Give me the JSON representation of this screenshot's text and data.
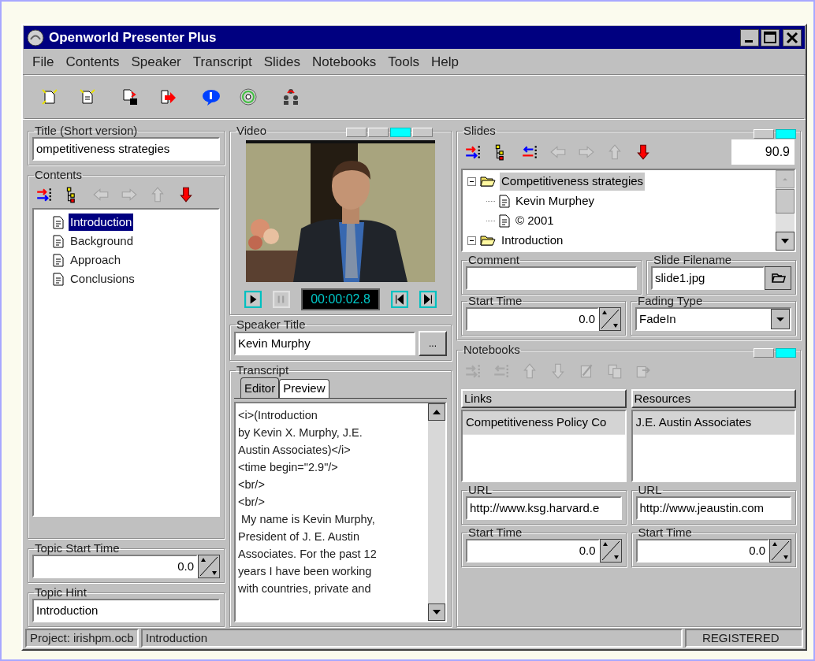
{
  "window": {
    "title": "Openworld Presenter Plus"
  },
  "menu": [
    {
      "label": "File"
    },
    {
      "label": "Contents"
    },
    {
      "label": "Speaker"
    },
    {
      "label": "Transcript"
    },
    {
      "label": "Slides"
    },
    {
      "label": "Notebooks"
    },
    {
      "label": "Tools"
    },
    {
      "label": "Help"
    }
  ],
  "title_group": {
    "label": "Title (Short version)",
    "value": "ompetitiveness strategies"
  },
  "contents": {
    "label": "Contents",
    "tools": [
      {
        "kind": "add",
        "disabled": false
      },
      {
        "kind": "outline",
        "disabled": false
      },
      {
        "kind": "left",
        "disabled": true
      },
      {
        "kind": "right",
        "disabled": true
      },
      {
        "kind": "up",
        "disabled": true
      },
      {
        "kind": "down",
        "disabled": false
      }
    ],
    "items": [
      {
        "label": "Introduction",
        "selected": true
      },
      {
        "label": "Background",
        "selected": false
      },
      {
        "label": "Approach",
        "selected": false
      },
      {
        "label": "Conclusions",
        "selected": false
      }
    ]
  },
  "topic_start_time": {
    "label": "Topic Start Time",
    "value": "0.0"
  },
  "topic_hint": {
    "label": "Topic Hint",
    "value": "Introduction"
  },
  "video": {
    "label": "Video",
    "view_buttons": [
      {
        "selected": false
      },
      {
        "selected": false
      },
      {
        "selected": true
      },
      {
        "selected": false
      }
    ],
    "time": "00:00:02.8",
    "controls": [
      {
        "kind": "play",
        "disabled": false
      },
      {
        "kind": "pause",
        "disabled": true
      },
      {
        "kind": "back",
        "disabled": false
      },
      {
        "kind": "forward",
        "disabled": false
      }
    ]
  },
  "speaker_title": {
    "label": "Speaker Title",
    "value": "Kevin Murphy",
    "button": "..."
  },
  "transcript": {
    "label": "Transcript",
    "tabs": [
      {
        "label": "Editor",
        "selected": true
      },
      {
        "label": "Preview",
        "selected": false
      }
    ],
    "lines": [
      "<i>(Introduction",
      "by Kevin X. Murphy, J.E.",
      "Austin Associates)</i>",
      "<time begin=\"2.9\"/>",
      "<br/>",
      "<br/>",
      " My name is Kevin Murphy,",
      "President of J. E. Austin",
      "Associates. For the past 12",
      "years I have been working",
      "with countries, private and"
    ]
  },
  "slides": {
    "label": "Slides",
    "view_buttons": [
      {
        "selected": false
      },
      {
        "selected": true
      }
    ],
    "tools": [
      {
        "kind": "add",
        "disabled": false
      },
      {
        "kind": "outline",
        "disabled": false
      },
      {
        "kind": "remove",
        "disabled": false
      },
      {
        "kind": "left",
        "disabled": true
      },
      {
        "kind": "right",
        "disabled": true
      },
      {
        "kind": "up",
        "disabled": true
      },
      {
        "kind": "down",
        "disabled": false
      }
    ],
    "zoom": "90.9",
    "tree": [
      {
        "label": "Competitiveness strategies",
        "kind": "folder",
        "expanded": true,
        "selected": true,
        "children": [
          {
            "label": "Kevin Murphey",
            "kind": "page",
            "selected": false
          },
          {
            "label": "© 2001",
            "kind": "page",
            "selected": false
          }
        ]
      },
      {
        "label": "Introduction",
        "kind": "folder",
        "expanded": true,
        "selected": false
      }
    ],
    "comment": {
      "label": "Comment"
    },
    "slide_filename": {
      "label": "Slide Filename",
      "value": "slide1.jpg"
    },
    "start_time": {
      "label": "Start Time",
      "value": "0.0"
    },
    "fading_type": {
      "label": "Fading Type",
      "value": "FadeIn"
    }
  },
  "notebooks": {
    "label": "Notebooks",
    "view_buttons": [
      {
        "selected": false
      },
      {
        "selected": true
      }
    ],
    "tools": [
      {
        "kind": "add",
        "disabled": true
      },
      {
        "kind": "remove",
        "disabled": true
      },
      {
        "kind": "up",
        "disabled": true
      },
      {
        "kind": "down",
        "disabled": true
      },
      {
        "kind": "edit",
        "disabled": true
      },
      {
        "kind": "copy",
        "disabled": true
      },
      {
        "kind": "paste",
        "disabled": true
      }
    ],
    "lists": [
      {
        "label": "Links",
        "items": [
          {
            "label": "Competitiveness Policy Co",
            "selected": true
          }
        ],
        "url": {
          "label": "URL",
          "value": "http://www.ksg.harvard.e"
        },
        "start_time": {
          "label": "Start Time",
          "value": "0.0"
        }
      },
      {
        "label": "Resources",
        "items": [
          {
            "label": "J.E. Austin Associates",
            "selected": true
          }
        ],
        "url": {
          "label": "URL",
          "value": "http://www.jeaustin.com"
        },
        "start_time": {
          "label": "Start Time",
          "value": "0.0"
        }
      }
    ]
  },
  "status_bar": [
    "Project: irishpm.ocb",
    "Introduction",
    "REGISTERED"
  ]
}
